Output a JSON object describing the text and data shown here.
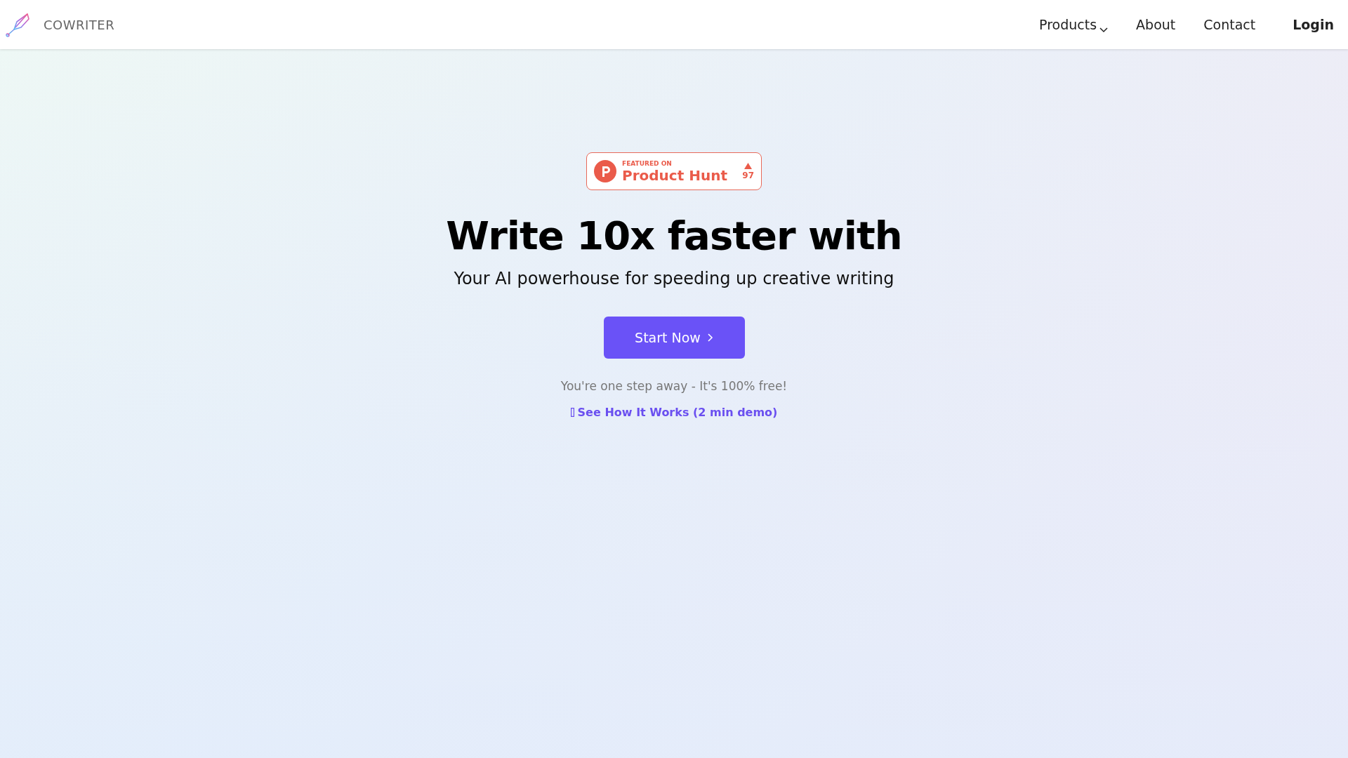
{
  "nav": {
    "brand": "COWRITER",
    "items": [
      {
        "label": "Products",
        "kind": "dropdown"
      },
      {
        "label": "About",
        "kind": "link"
      },
      {
        "label": "Contact",
        "kind": "link"
      },
      {
        "label": "Login",
        "kind": "login"
      }
    ]
  },
  "badge": {
    "caption": "FEATURED ON",
    "title": "Product Hunt",
    "count": "97"
  },
  "hero": {
    "heading": "Write 10x faster with",
    "subtitle": "Your AI powerhouse for speeding up creative writing",
    "cta": "Start Now",
    "note": "You're one step away - It's 100% free!",
    "demo_link": "See How It Works (2 min demo)"
  }
}
